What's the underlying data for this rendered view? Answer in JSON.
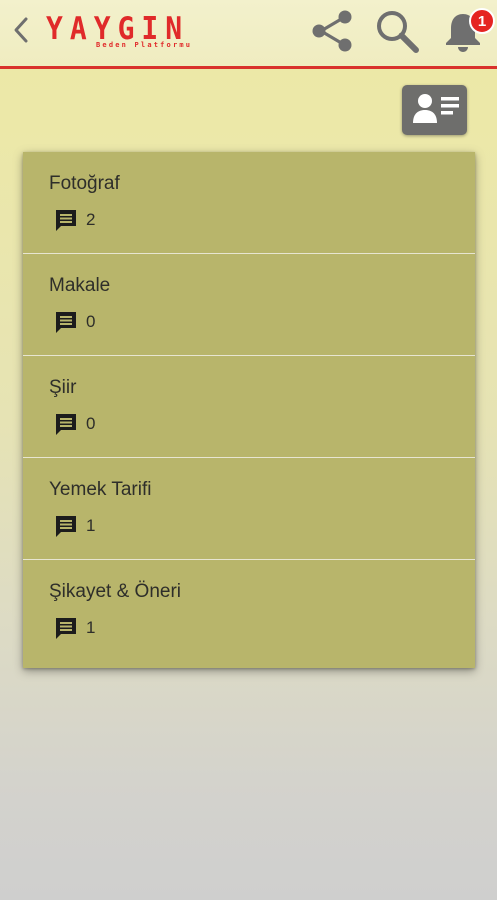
{
  "header": {
    "back_icon": "chevron-left-icon",
    "logo_title": "YAYGIN",
    "logo_subtitle": "Beden Platformu",
    "share_icon": "share-icon",
    "search_icon": "search-icon",
    "notifications_icon": "bell-icon",
    "notification_count": "1"
  },
  "profile_button": {
    "icon": "contact-card-icon"
  },
  "categories": [
    {
      "name": "Fotoğraf",
      "comment_count": "2",
      "icon": "comment-icon"
    },
    {
      "name": "Makale",
      "comment_count": "0",
      "icon": "comment-icon"
    },
    {
      "name": "Şiir",
      "comment_count": "0",
      "icon": "comment-icon"
    },
    {
      "name": "Yemek Tarifi",
      "comment_count": "1",
      "icon": "comment-icon"
    },
    {
      "name": "Şikayet & Öneri",
      "comment_count": "1",
      "icon": "comment-icon"
    }
  ],
  "colors": {
    "accent_red": "#e02a2a",
    "badge_red": "#e52421",
    "list_background": "#b8b56b",
    "page_background_top": "#ede9a6",
    "page_background_bottom": "#cfcfce",
    "header_icon_gray": "#6f6f6f"
  }
}
